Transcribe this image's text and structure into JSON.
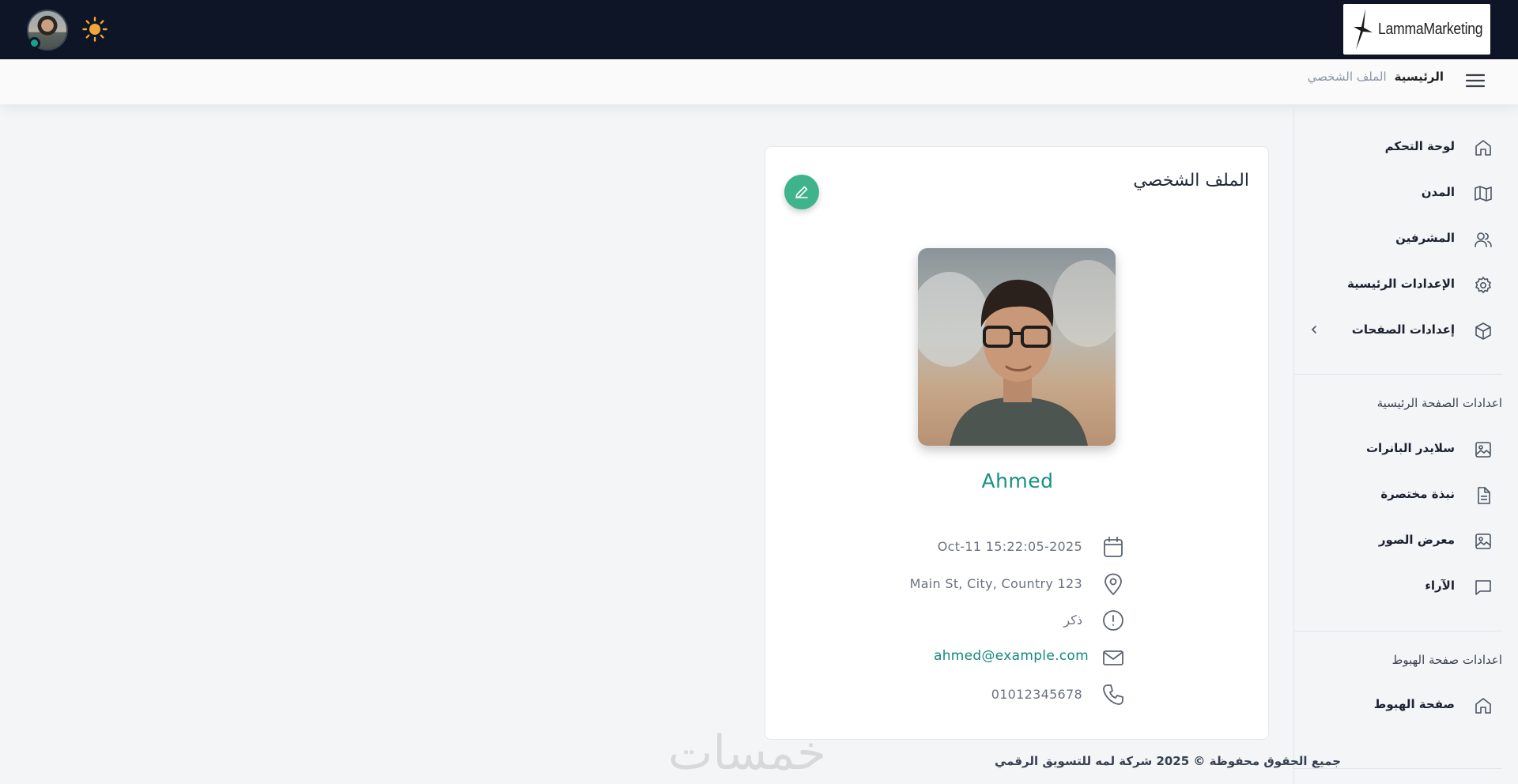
{
  "topbar": {
    "brand": "LammaMarketing",
    "logo_icon": "star-logo-icon",
    "theme_icon": "sun-icon",
    "avatar_icon": "user-avatar",
    "colors": {
      "background": "#0d1526",
      "online": "#14a38b",
      "sun": "#f0a53a"
    }
  },
  "breadcrumb": {
    "home": "الرئيسية",
    "current": "الملف الشخصي",
    "menu_icon": "hamburger-icon"
  },
  "sidebar": {
    "items": [
      {
        "label": "لوحة التحكم",
        "icon": "home-icon"
      },
      {
        "label": "المدن",
        "icon": "map-icon"
      },
      {
        "label": "المشرفين",
        "icon": "users-icon"
      },
      {
        "label": "الإعدادات الرئيسية",
        "icon": "gear-icon"
      },
      {
        "label": "إعدادات الصفحات",
        "icon": "cube-icon",
        "has_submenu": true
      }
    ],
    "section_home": "اعدادات الصفحة الرئيسية",
    "home_items": [
      {
        "label": "سلايدر البانرات",
        "icon": "image-icon"
      },
      {
        "label": "نبذة مختصرة",
        "icon": "document-icon"
      },
      {
        "label": "معرض الصور",
        "icon": "image-icon"
      },
      {
        "label": "الآراء",
        "icon": "chat-icon"
      }
    ],
    "section_landing": "اعدادات صفحة الهبوط",
    "landing_items": [
      {
        "label": "صفحة الهبوط",
        "icon": "home-icon"
      }
    ]
  },
  "profile": {
    "title": "الملف الشخصي",
    "edit_icon": "pencil-icon",
    "name": "Ahmed",
    "date": "Oct-11 15:22:05-2025",
    "address": "Main St, City, Country 123",
    "gender": "ذكر",
    "email": "ahmed@example.com",
    "phone": "01012345678",
    "colors": {
      "accent": "#3fb38c",
      "name": "#17917f",
      "email": "#14897a"
    }
  },
  "footer": {
    "copyright": "جميع الحقوق محفوظة © 2025 شركة لمه للتسويق الرقمي",
    "watermark": "خمسات"
  }
}
